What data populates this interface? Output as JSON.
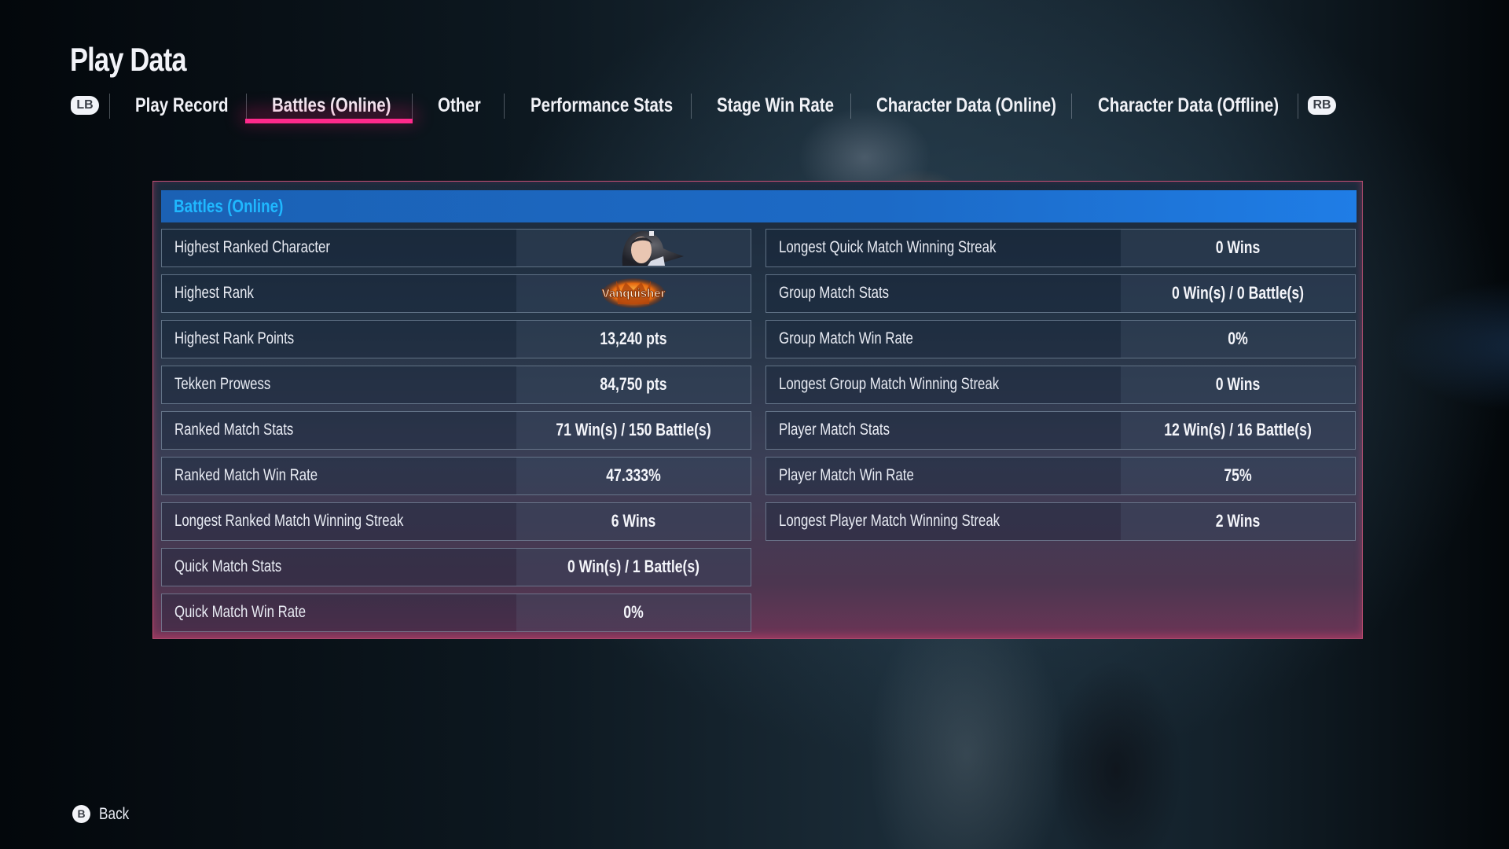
{
  "page": {
    "title": "Play Data"
  },
  "tabs": {
    "left_bumper": "LB",
    "right_bumper": "RB",
    "items": [
      {
        "label": "Play Record",
        "active": false
      },
      {
        "label": "Battles (Online)",
        "active": true
      },
      {
        "label": "Other",
        "active": false
      },
      {
        "label": "Performance Stats",
        "active": false
      },
      {
        "label": "Stage Win Rate",
        "active": false
      },
      {
        "label": "Character Data (Online)",
        "active": false
      },
      {
        "label": "Character Data (Offline)",
        "active": false
      }
    ],
    "active_color": "#ff2a8c"
  },
  "panel": {
    "header": "Battles (Online)",
    "header_color": "#1fb8ff",
    "left_rows": [
      {
        "label": "Highest Ranked Character",
        "value": "",
        "value_type": "character-portrait-image"
      },
      {
        "label": "Highest Rank",
        "value": "Vanquisher",
        "value_type": "rank-badge-image"
      },
      {
        "label": "Highest Rank Points",
        "value": "13,240 pts"
      },
      {
        "label": "Tekken Prowess",
        "value": "84,750 pts"
      },
      {
        "label": "Ranked Match Stats",
        "value": "71 Win(s) / 150 Battle(s)"
      },
      {
        "label": "Ranked Match Win Rate",
        "value": "47.333%"
      },
      {
        "label": "Longest Ranked Match Winning Streak",
        "value": "6 Wins"
      },
      {
        "label": "Quick Match Stats",
        "value": "0 Win(s) / 1 Battle(s)"
      },
      {
        "label": "Quick Match Win Rate",
        "value": "0%"
      }
    ],
    "right_rows": [
      {
        "label": "Longest Quick Match Winning Streak",
        "value": "0 Wins"
      },
      {
        "label": "Group Match Stats",
        "value": "0 Win(s) / 0 Battle(s)"
      },
      {
        "label": "Group Match Win Rate",
        "value": "0%"
      },
      {
        "label": "Longest Group Match Winning Streak",
        "value": "0 Wins"
      },
      {
        "label": "Player Match Stats",
        "value": "12 Win(s) / 16 Battle(s)"
      },
      {
        "label": "Player Match Win Rate",
        "value": "75%"
      },
      {
        "label": "Longest Player Match Winning Streak",
        "value": "2 Wins"
      }
    ]
  },
  "footer": {
    "back_button_glyph": "B",
    "back_label": "Back"
  }
}
